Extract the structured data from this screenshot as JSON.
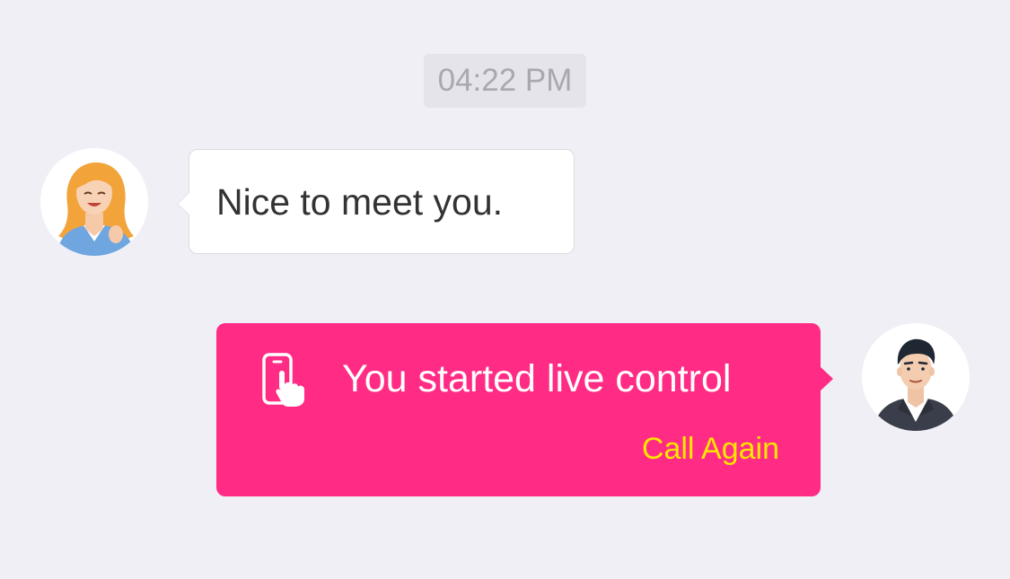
{
  "timestamp": "04:22 PM",
  "messages": [
    {
      "direction": "incoming",
      "sender_avatar": "woman-avatar",
      "text": "Nice to meet you."
    },
    {
      "direction": "outgoing",
      "sender_avatar": "man-avatar",
      "icon": "phone-touch-icon",
      "text": "You started live control",
      "action_label": "Call Again"
    }
  ],
  "colors": {
    "background": "#f0eff5",
    "outgoing_bubble": "#ff2b85",
    "incoming_bubble": "#ffffff",
    "action_text": "#ffe600",
    "timestamp_bg": "#e5e4eb",
    "timestamp_text": "#a9a8b0"
  }
}
